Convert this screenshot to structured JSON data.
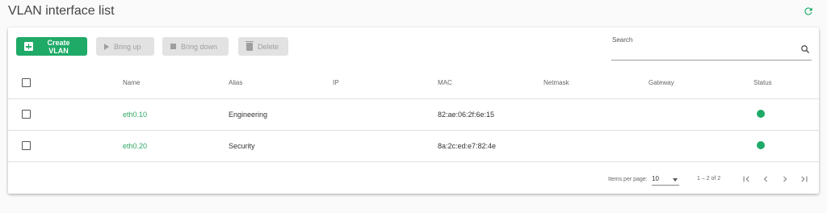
{
  "page": {
    "title": "VLAN interface list"
  },
  "colors": {
    "accent": "#1faa68",
    "link": "#2fa865",
    "status_up": "#1faa68",
    "disabled_bg": "#e2e2e2",
    "disabled_text": "#9e9e9e"
  },
  "toolbar": {
    "create_label": "Create VLAN",
    "bring_up_label": "Bring up",
    "bring_down_label": "Bring down",
    "delete_label": "Delete"
  },
  "search": {
    "label": "Search",
    "value": ""
  },
  "table": {
    "columns": [
      "Name",
      "Alias",
      "IP",
      "MAC",
      "Netmask",
      "Gateway",
      "Status"
    ],
    "rows": [
      {
        "name": "eth0.10",
        "alias": "Engineering",
        "ip": "",
        "mac": "82:ae:06:2f:6e:15",
        "netmask": "",
        "gateway": "",
        "status": "up"
      },
      {
        "name": "eth0.20",
        "alias": "Security",
        "ip": "",
        "mac": "8a:2c:ed:e7:82:4e",
        "netmask": "",
        "gateway": "",
        "status": "up"
      }
    ]
  },
  "pagination": {
    "items_per_page_label": "Items per page:",
    "items_per_page": "10",
    "range": "1 – 2 of 2"
  },
  "icons": [
    "refresh-icon",
    "plus-icon",
    "play-icon",
    "stop-icon",
    "trash-icon",
    "search-icon",
    "chevron-down-icon",
    "first-page-icon",
    "prev-page-icon",
    "next-page-icon",
    "last-page-icon"
  ]
}
